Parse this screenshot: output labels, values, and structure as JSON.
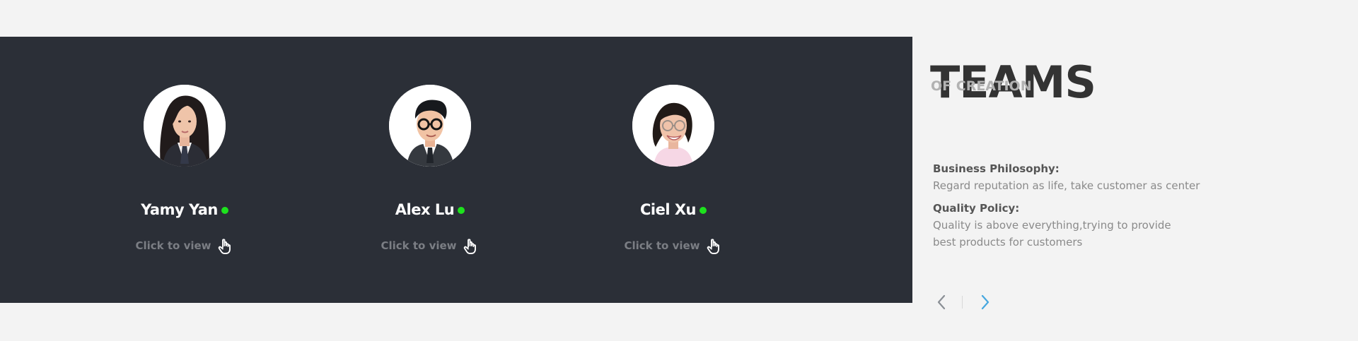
{
  "team_members": [
    {
      "name": "Yamy Yan",
      "action_label": "Click to view",
      "status_color": "#1de21d",
      "avatar_icon": "portrait-woman-long-hair"
    },
    {
      "name": "Alex Lu",
      "action_label": "Click to view",
      "status_color": "#1de21d",
      "avatar_icon": "portrait-man-glasses"
    },
    {
      "name": "Ciel Xu",
      "action_label": "Click to view",
      "status_color": "#1de21d",
      "avatar_icon": "portrait-woman-glasses"
    }
  ],
  "section": {
    "title": "TEAMS",
    "subtitle": "OF CREATION"
  },
  "philosophy": {
    "business_heading": "Business Philosophy:",
    "business_text": "Regard reputation as life, take customer as center",
    "quality_heading": "Quality Policy:",
    "quality_line_1": "Quality is above everything,trying to provide",
    "quality_line_2": "best products for customers"
  },
  "navigation": {
    "previous_icon": "chevron-left-icon",
    "next_icon": "chevron-right-icon"
  },
  "colors": {
    "panel_background": "#2b2f37",
    "page_background": "#f3f3f3",
    "accent_blue": "#46a7df",
    "status_green": "#1de21d"
  }
}
